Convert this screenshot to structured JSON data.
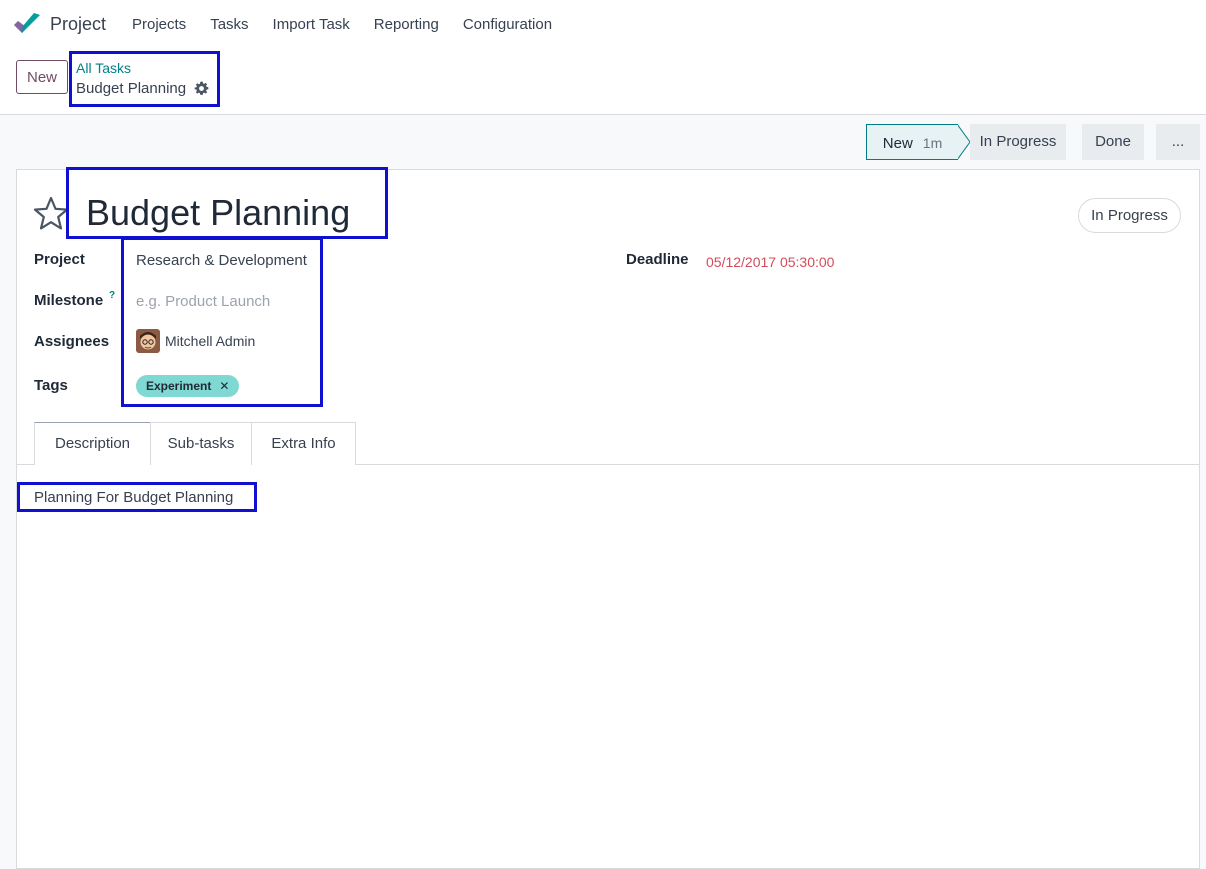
{
  "navbar": {
    "app_name": "Project",
    "menu": [
      "Projects",
      "Tasks",
      "Import Task",
      "Reporting",
      "Configuration"
    ]
  },
  "control_panel": {
    "new_label": "New",
    "breadcrumb_parent": "All Tasks",
    "breadcrumb_current": "Budget Planning"
  },
  "stages": {
    "new": "New",
    "new_time": "1m",
    "in_progress": "In Progress",
    "done": "Done",
    "more": "..."
  },
  "form": {
    "title": "Budget Planning",
    "status": "In Progress",
    "labels": {
      "project": "Project",
      "milestone": "Milestone",
      "milestone_help": "?",
      "assignees": "Assignees",
      "tags": "Tags",
      "deadline": "Deadline"
    },
    "values": {
      "project": "Research & Development",
      "milestone_placeholder": "e.g. Product Launch",
      "assignee": "Mitchell Admin",
      "tag": "Experiment",
      "tag_remove": "✕",
      "deadline": "05/12/2017 05:30:00"
    },
    "tabs": [
      "Description",
      "Sub-tasks",
      "Extra Info"
    ],
    "description": "Planning For Budget Planning"
  },
  "colors": {
    "accent": "#714b67",
    "link": "#017e84",
    "deadline": "#d44c59",
    "tag_bg": "#7fd8d1",
    "annotation_border": "#1010d0"
  },
  "icons": [
    "project-logo-icon",
    "gear-icon",
    "star-icon",
    "avatar-icon",
    "help-icon",
    "close-icon"
  ]
}
